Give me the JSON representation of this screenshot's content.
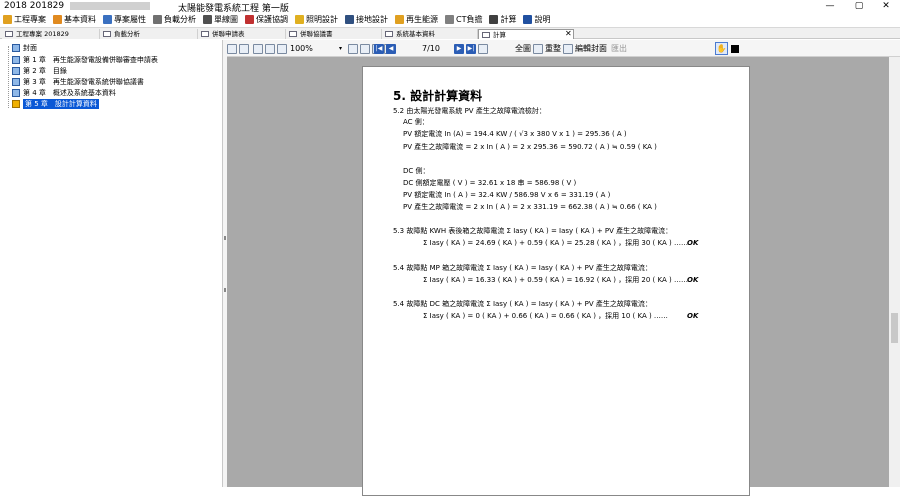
{
  "window": {
    "title_left": "2018 201829",
    "title_center": "太陽能發電系統工程 第一版",
    "minimize": "—",
    "maximize": "▢",
    "close": "✕"
  },
  "menu": [
    {
      "label": "工程專案",
      "icon": "folder-icon",
      "color": "#e0a020"
    },
    {
      "label": "基本資料",
      "icon": "document-icon",
      "color": "#e08a20"
    },
    {
      "label": "專案屬性",
      "icon": "properties-icon",
      "color": "#3a70c0"
    },
    {
      "label": "負載分析",
      "icon": "chart-icon",
      "color": "#707070"
    },
    {
      "label": "單線圖",
      "icon": "diagram-icon",
      "color": "#505050"
    },
    {
      "label": "保護協調",
      "icon": "protection-icon",
      "color": "#c03030"
    },
    {
      "label": "照明設計",
      "icon": "bulb-icon",
      "color": "#e0b020"
    },
    {
      "label": "接地設計",
      "icon": "ground-icon",
      "color": "#305080"
    },
    {
      "label": "再生能源",
      "icon": "energy-icon",
      "color": "#e0a020"
    },
    {
      "label": "CT負擔",
      "icon": "ct-icon",
      "color": "#808080"
    },
    {
      "label": "計算",
      "icon": "calculator-icon",
      "color": "#404040"
    },
    {
      "label": "說明",
      "icon": "help-icon",
      "color": "#2050a0"
    }
  ],
  "tabs": [
    {
      "label": "工程專案 201829"
    },
    {
      "label": "負載分析"
    },
    {
      "label": "併聯申請表"
    },
    {
      "label": "併聯協議書"
    },
    {
      "label": "系統基本資料"
    },
    {
      "label": "計算"
    }
  ],
  "tree": [
    {
      "label": "封面"
    },
    {
      "label": "第 1 章　再生能源發電設備併聯審查申請表"
    },
    {
      "label": "第 2 章　目錄"
    },
    {
      "label": "第 3 章　再生能源發電系統併聯協議書"
    },
    {
      "label": "第 4 章　概述及系統基本資料"
    },
    {
      "label": "第 5 章　設計計算資料"
    }
  ],
  "toolbar": {
    "zoom": "100%",
    "page": "7/10",
    "fullscreen_label": "全圖",
    "reset_label": "重整",
    "edit_cover_label": "編輯封面",
    "exit_label": "匯出"
  },
  "document": {
    "heading": "5. 設計計算資料",
    "lines": [
      "5.2 由太陽光發電系統 PV 產生之故障電流檢討：",
      "AC 側：",
      "PV 額定電流 In (A) =  194.4    KW / ( √3  x  380   V x   1   ) =     295.36     ( A )",
      "PV 產生之故障電流  = 2 x In ( A ) = 2 x 295.36  =  590.72  ( A ) ≒  0.59  ( KA )",
      "DC 側：",
      "DC 側額定電壓 ( V )  =  32.61 x 18 串 = 586.98 ( V )",
      "PV  額定電流 In ( A )   =  32.4 KW / 586.98 V x 6 = 331.19 ( A )",
      "PV 產生之故障電流  = 2 x In ( A ) = 2 x  331.19  =  662.38  ( A ) ≒  0.66  ( KA )",
      "5.3 故障點 KWH 表後箱之故障電流 Σ Iasy ( KA ) = Iasy ( KA ) + PV 產生之故障電流：",
      "Σ Iasy ( KA ) =  24.69  ( KA )  +   0.59   ( KA )  =  25.28  ( KA ) ，採用   30    ( KA ) ……",
      "5.4 故障點 MP 箱之故障電流 Σ Iasy ( KA ) = Iasy ( KA ) + PV 產生之故障電流：",
      "Σ Iasy ( KA ) =  16.33  ( KA )  +   0.59   ( KA )  =  16.92  ( KA ) ，採用   20    ( KA ) ……",
      "5.4 故障點 DC 箱之故障電流 Σ Iasy ( KA ) = Iasy ( KA ) + PV 產生之故障電流：",
      "Σ Iasy ( KA ) =     0    ( KA )  +   0.66   ( KA )  =   0.66  ( KA ) ，採用   10    ( KA ) ……"
    ],
    "ok": "OK"
  }
}
